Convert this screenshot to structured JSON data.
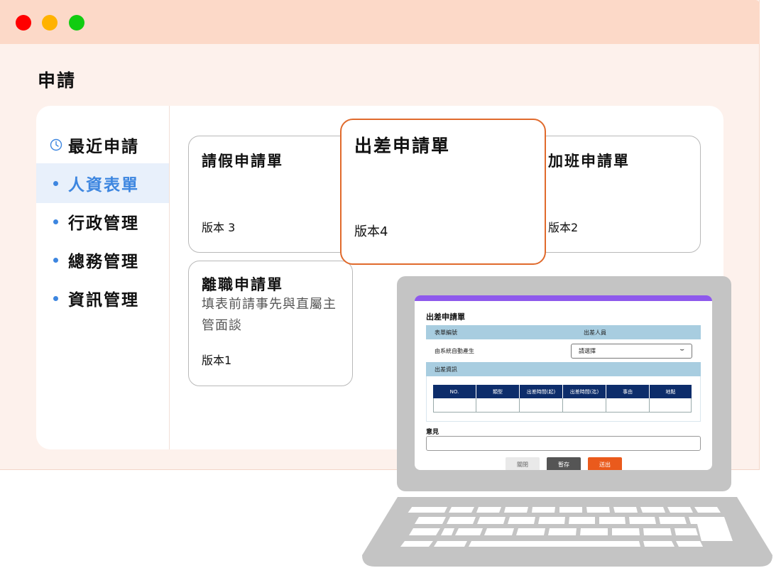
{
  "window": {
    "controls": [
      "close-dot",
      "minimize-dot",
      "maximize-dot"
    ],
    "colors": {
      "close": "#ff0000",
      "minimize": "#ffb200",
      "maximize": "#11cc11",
      "titlebar": "#fcd9c8",
      "accent": "#3d86e0",
      "highlight": "#e06a2c"
    }
  },
  "page": {
    "title": "申請"
  },
  "sidebar": {
    "items": [
      {
        "label": "最近申請",
        "icon": "clock-icon"
      },
      {
        "label": "人資表單",
        "active": true
      },
      {
        "label": "行政管理"
      },
      {
        "label": "總務管理"
      },
      {
        "label": "資訊管理"
      }
    ]
  },
  "cards": [
    {
      "title": "請假申請單",
      "version": "版本 3"
    },
    {
      "title": "出差申請單",
      "version": "版本4",
      "highlighted": true
    },
    {
      "title": "加班申請單",
      "version": "版本2"
    },
    {
      "title": "離職申請單",
      "description": "填表前請事先與直屬主管面談",
      "version": "版本1"
    }
  ],
  "laptop_form": {
    "title": "出差申請單",
    "header_row": {
      "col1": "表單編號",
      "col2": "出差人員"
    },
    "form_number_value": "由系統自動產生",
    "select_placeholder": "請選擇",
    "section": "出差資訊",
    "table_headers": [
      "NO.",
      "類型",
      "出差時間(起)",
      "出差時間(迄)",
      "事由",
      "地點"
    ],
    "opinion_label": "意見",
    "buttons": {
      "close": "關閉",
      "save": "暫存",
      "submit": "送出"
    }
  }
}
